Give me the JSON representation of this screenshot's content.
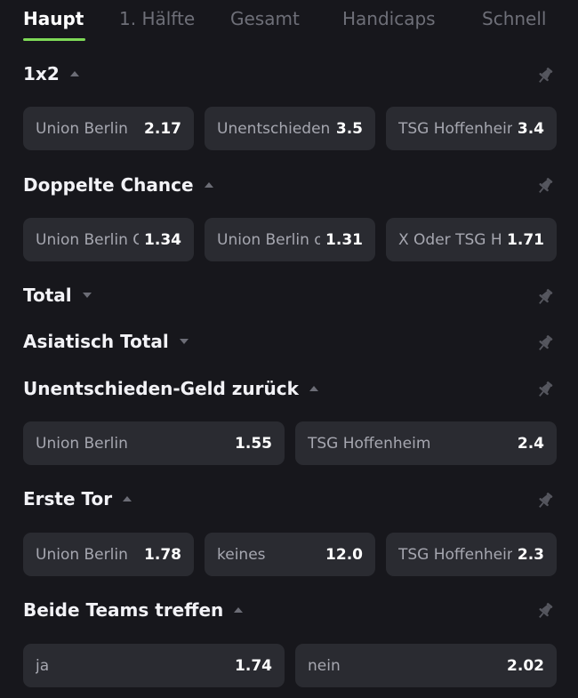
{
  "tabs": [
    "Haupt",
    "1. Hälfte",
    "Gesamt",
    "Handicaps",
    "Schnell"
  ],
  "sections": [
    {
      "title": "1x2",
      "caret": "up",
      "odds": [
        {
          "label": "Union Berlin",
          "value": "2.17"
        },
        {
          "label": "Unentschieden",
          "value": "3.5"
        },
        {
          "label": "TSG Hoffenheim",
          "value": "3.4"
        }
      ]
    },
    {
      "title": "Doppelte Chance",
      "caret": "up",
      "odds": [
        {
          "label": "Union Berlin Oder X",
          "value": "1.34"
        },
        {
          "label": "Union Berlin oder TSG Hoffenheim",
          "value": "1.31"
        },
        {
          "label": "X Oder TSG Hoffenheim",
          "value": "1.71"
        }
      ]
    },
    {
      "title": "Total",
      "caret": "down"
    },
    {
      "title": "Asiatisch Total",
      "caret": "down"
    },
    {
      "title": "Unentschieden-Geld zurück",
      "caret": "up",
      "odds": [
        {
          "label": "Union Berlin",
          "value": "1.55"
        },
        {
          "label": "TSG Hoffenheim",
          "value": "2.4"
        }
      ]
    },
    {
      "title": "Erste Tor",
      "caret": "up",
      "odds": [
        {
          "label": "Union Berlin",
          "value": "1.78"
        },
        {
          "label": "keines",
          "value": "12.0"
        },
        {
          "label": "TSG Hoffenheim",
          "value": "2.3"
        }
      ]
    },
    {
      "title": "Beide Teams treffen",
      "caret": "up",
      "odds": [
        {
          "label": "ja",
          "value": "1.74"
        },
        {
          "label": "nein",
          "value": "2.02"
        }
      ]
    }
  ],
  "icons": {
    "pin": "pin-icon",
    "caret_up": "chevron-up-icon",
    "caret_down": "chevron-down-icon"
  },
  "colors": {
    "background": "#17171c",
    "tile": "#2a2b31",
    "accent": "#7ed957",
    "muted_text": "#a6a7b0",
    "inactive_tab": "#6e6f78"
  }
}
